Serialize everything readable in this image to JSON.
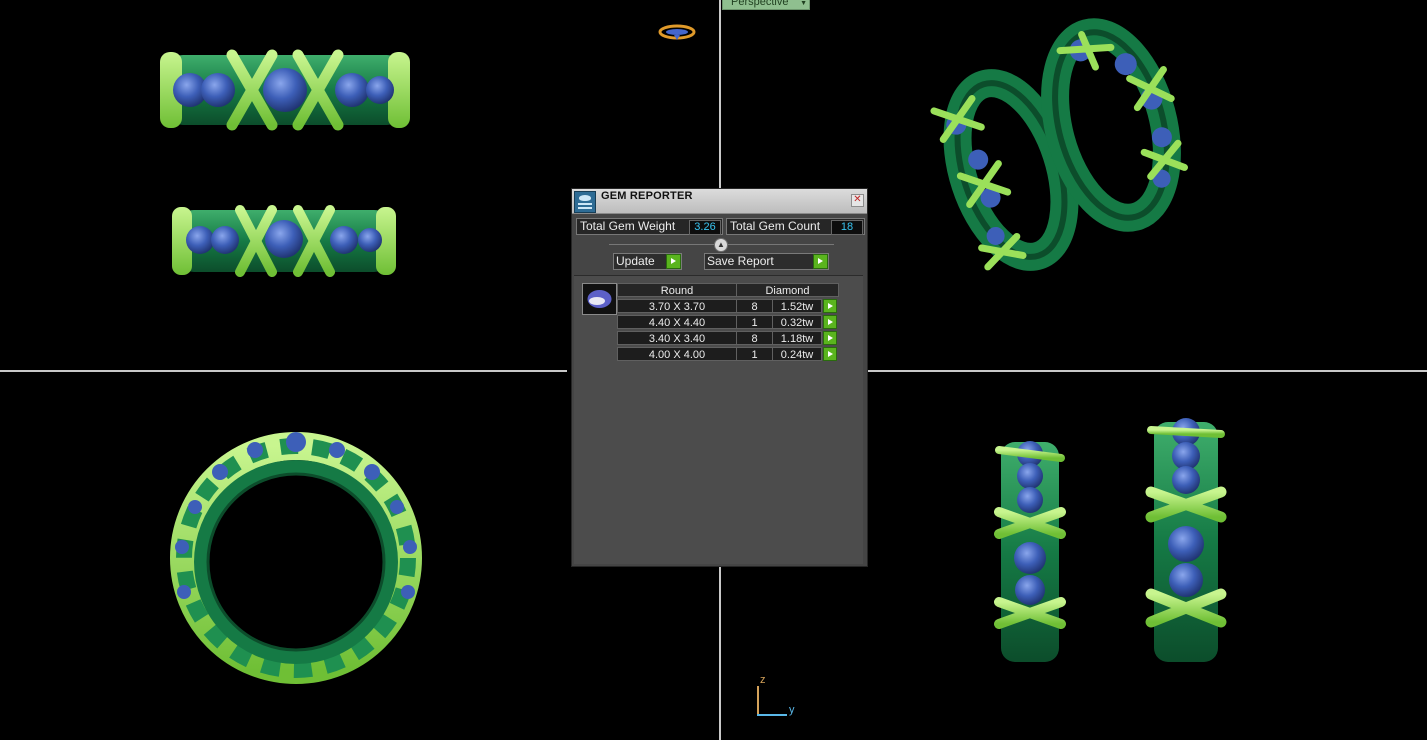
{
  "viewport": {
    "label": "Perspective",
    "axis_z": "z",
    "axis_y": "y"
  },
  "dialog": {
    "title": "GEM REPORTER",
    "total_weight_label": "Total Gem Weight",
    "total_weight_value": "3.26",
    "total_count_label": "Total Gem Count",
    "total_count_value": "18",
    "update_label": "Update",
    "save_label": "Save Report",
    "table": {
      "shape_header": "Round",
      "type_header": "Diamond",
      "rows": [
        {
          "size": "3.70 X 3.70",
          "count": "8",
          "weight": "1.52tw"
        },
        {
          "size": "4.40 X 4.40",
          "count": "1",
          "weight": "0.32tw"
        },
        {
          "size": "3.40 X 3.40",
          "count": "8",
          "weight": "1.18tw"
        },
        {
          "size": "4.00 X 4.00",
          "count": "1",
          "weight": "0.24tw"
        }
      ]
    }
  },
  "colors": {
    "band": "#157a45",
    "band_dark": "#0c4d2b",
    "band_light": "#3fae6c",
    "cross": "#9be05a",
    "gem": "#3d5fb8",
    "gem_light": "#6f8fe0",
    "accent_value": "#39c4f0",
    "button_green": "#5ab41e"
  }
}
